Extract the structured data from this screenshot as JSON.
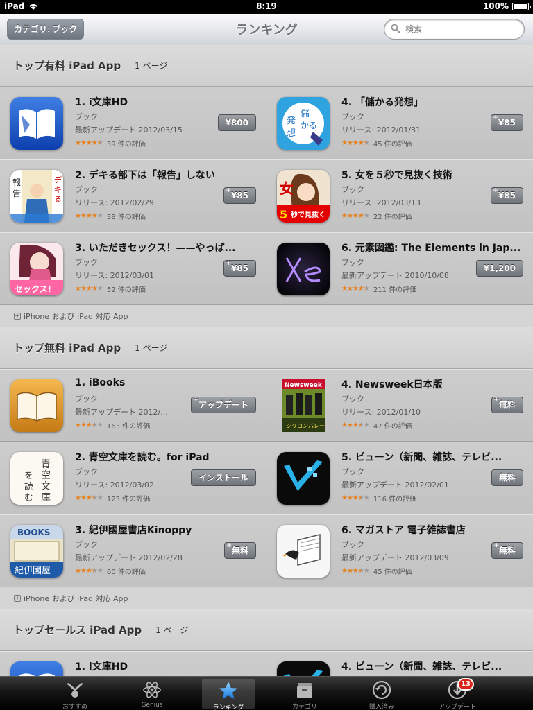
{
  "status_bar": {
    "device": "iPad",
    "time": "8:19",
    "battery": "100%"
  },
  "nav": {
    "category_button": "カテゴリ: ブック",
    "title": "ランキング",
    "search_placeholder": "検索"
  },
  "sections": [
    {
      "title": "トップ有料 iPad App",
      "page": "1 ページ",
      "apps": [
        {
          "name": "1. i文庫HD",
          "category": "ブック",
          "date_text": "最新アップデート  2012/03/15",
          "stars": 4.5,
          "ratings_text": "39 件の評価",
          "button": "¥800",
          "universal": false
        },
        {
          "name": "4. 「儲かる発想」",
          "category": "ブック",
          "date_text": "リリース: 2012/01/31",
          "stars": 4.5,
          "ratings_text": "45 件の評価",
          "button": "¥85",
          "universal": true
        },
        {
          "name": "2. デキる部下は「報告」しない",
          "category": "ブック",
          "date_text": "リリース: 2012/02/29",
          "stars": 4,
          "ratings_text": "38 件の評価",
          "button": "¥85",
          "universal": true
        },
        {
          "name": "5. 女を５秒で見抜く技術",
          "category": "ブック",
          "date_text": "リリース: 2012/03/13",
          "stars": 4,
          "ratings_text": "22 件の評価",
          "button": "¥85",
          "universal": true
        },
        {
          "name": "3. いただきセックス！——やっぱ...",
          "category": "ブック",
          "date_text": "リリース: 2012/03/01",
          "stars": 4,
          "ratings_text": "52 件の評価",
          "button": "¥85",
          "universal": true
        },
        {
          "name": "6. 元素図鑑: The Elements in Jap...",
          "category": "ブック",
          "date_text": "最新アップデート  2010/10/08",
          "stars": 4.5,
          "ratings_text": "211 件の評価",
          "button": "¥1,200",
          "universal": false
        }
      ],
      "footer": "iPhone および iPad 対応 App"
    },
    {
      "title": "トップ無料 iPad App",
      "page": "1 ページ",
      "apps": [
        {
          "name": "1. iBooks",
          "category": "ブック",
          "date_text": "最新アップデート  2012/...",
          "stars": 3.5,
          "ratings_text": "163 件の評価",
          "button": "アップデート",
          "universal": true
        },
        {
          "name": "4. Newsweek日本版",
          "category": "ブック",
          "date_text": "リリース: 2012/01/10",
          "stars": 3.5,
          "ratings_text": "47 件の評価",
          "button": "無料",
          "universal": true
        },
        {
          "name": "2. 青空文庫を読む。for iPad",
          "category": "ブック",
          "date_text": "リリース: 2012/03/02",
          "stars": 3.5,
          "ratings_text": "123 件の評価",
          "button": "インストール",
          "universal": false
        },
        {
          "name": "5. ビューン（新聞、雑誌、テレビ...",
          "category": "ブック",
          "date_text": "最新アップデート  2012/02/01",
          "stars": 3.5,
          "ratings_text": "116 件の評価",
          "button": "無料",
          "universal": false
        },
        {
          "name": "3. 紀伊國屋書店Kinoppy",
          "category": "ブック",
          "date_text": "最新アップデート  2012/02/28",
          "stars": 3.5,
          "ratings_text": "60 件の評価",
          "button": "無料",
          "universal": true
        },
        {
          "name": "6. マガストア 電子雑誌書店",
          "category": "ブック",
          "date_text": "最新アップデート  2012/03/09",
          "stars": 3.5,
          "ratings_text": "45 件の評価",
          "button": "無料",
          "universal": true
        }
      ],
      "footer": "iPhone および iPad 対応 App"
    },
    {
      "title": "トップセールス iPad App",
      "page": "1 ページ",
      "apps": [
        {
          "name": "1. i文庫HD"
        },
        {
          "name": "4. ビューン（新聞、雑誌、テレビ..."
        }
      ]
    }
  ],
  "tabbar": {
    "tabs": [
      {
        "label": "おすすめ",
        "icon": "featured-icon"
      },
      {
        "label": "Genius",
        "icon": "genius-icon"
      },
      {
        "label": "ランキング",
        "icon": "star-icon",
        "active": true
      },
      {
        "label": "カテゴリ",
        "icon": "categories-icon"
      },
      {
        "label": "購入済み",
        "icon": "purchased-icon"
      },
      {
        "label": "アップデート",
        "icon": "updates-icon",
        "badge": "13"
      }
    ]
  }
}
